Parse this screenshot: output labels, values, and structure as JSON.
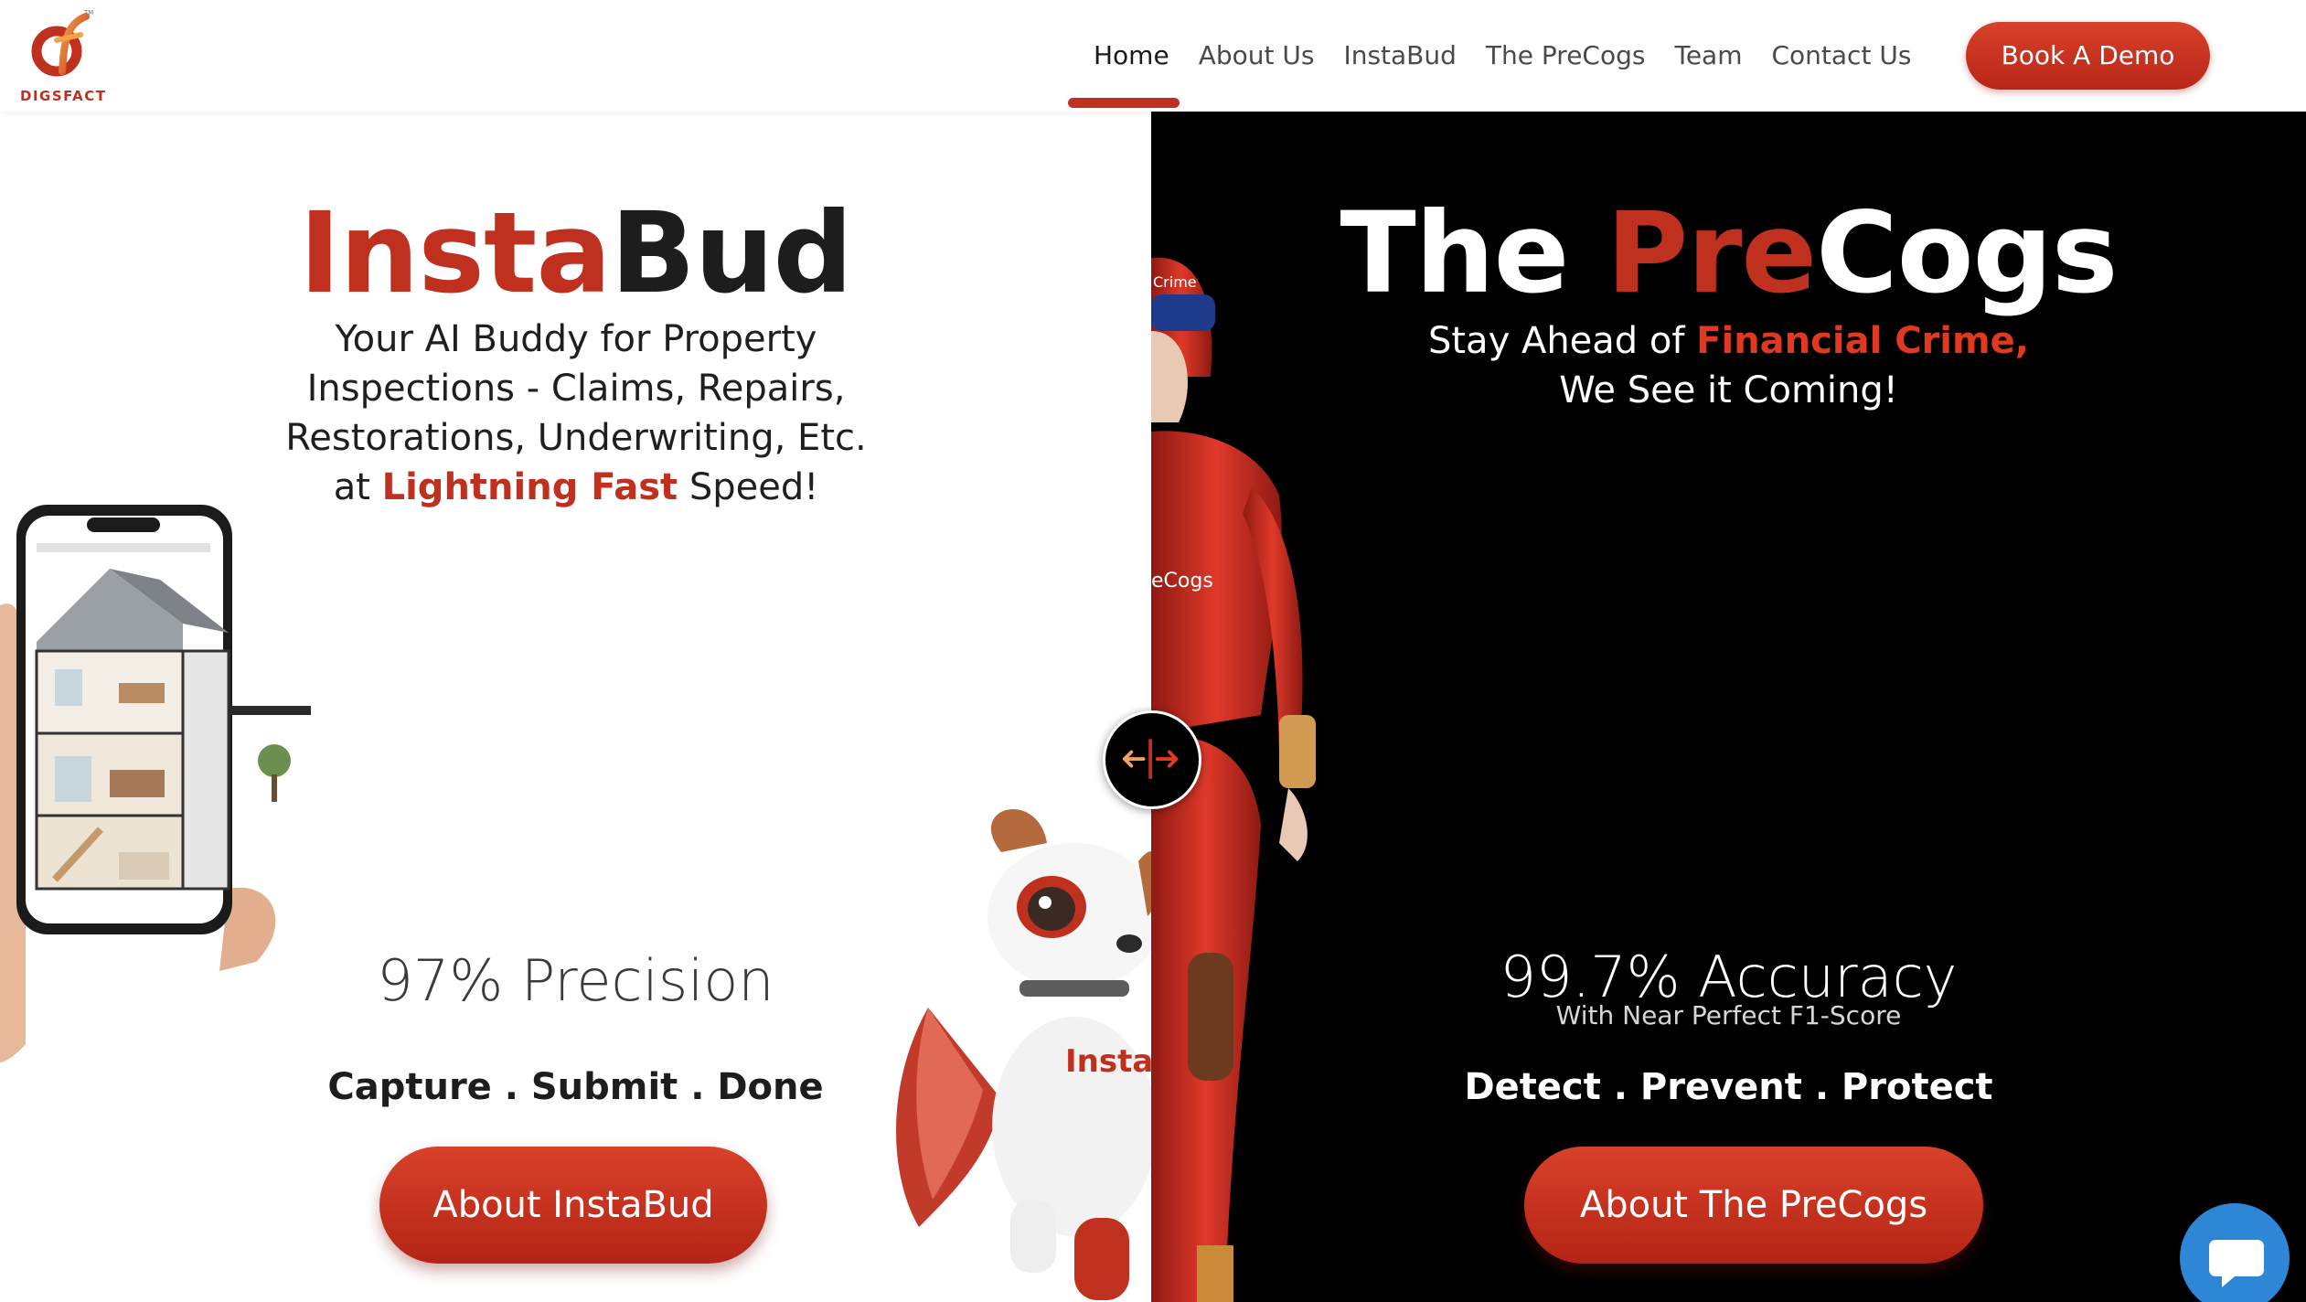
{
  "brand": {
    "name": "DIGSFACT",
    "accent_color": "#c0301f"
  },
  "nav": {
    "items": [
      {
        "label": "Home",
        "active": true
      },
      {
        "label": "About Us",
        "active": false
      },
      {
        "label": "InstaBud",
        "active": false
      },
      {
        "label": "The PreCogs",
        "active": false
      },
      {
        "label": "Team",
        "active": false
      },
      {
        "label": "Contact Us",
        "active": false
      }
    ],
    "cta_label": "Book A Demo"
  },
  "left": {
    "title_accent": "Insta",
    "title_rest": "Bud",
    "subtitle_pre": "Your AI Buddy for Property Inspections - Claims, Repairs, Restorations, Underwriting, Etc. at ",
    "subtitle_highlight": "Lightning Fast",
    "subtitle_post": " Speed!",
    "stat": "97% Precision",
    "motto": "Capture . Submit . Done",
    "cta_label": "About InstaBud",
    "dog_badge": "Insta"
  },
  "right": {
    "title_pre": "The ",
    "title_accent": "Pre",
    "title_rest": "Cogs",
    "subtitle_pre": "Stay Ahead of ",
    "subtitle_highlight": "Financial Crime,",
    "subtitle_line2": "We See it Coming!",
    "stat": "99.7% Accuracy",
    "stat_sub": "With Near Perfect F1-Score",
    "motto": "Detect . Prevent . Protect",
    "cta_label": "About The PreCogs",
    "suit_badge": "eCogs",
    "helmet_text": "Crime"
  },
  "slider": {
    "icon": "split-arrows-icon"
  },
  "chat": {
    "icon": "chat-bubble-icon",
    "color": "#2e86d6"
  }
}
